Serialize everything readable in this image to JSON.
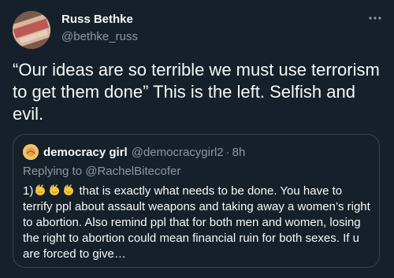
{
  "tweet": {
    "author": {
      "display_name": "Russ Bethke",
      "handle": "@bethke_russ"
    },
    "text": "“Our ideas are so terrible we must use terrorism to get them done” This is the left. Selfish and evil.",
    "more_icon": "more-horizontal-icon"
  },
  "quoted_tweet": {
    "author": {
      "display_name": "democracy girl",
      "handle": "@democracygirl2",
      "separator": "·",
      "time": "8h"
    },
    "replying_prefix": "Replying to ",
    "replying_to": "@RachelBitecofer",
    "body_prefix": "1)",
    "emoji": [
      "clapping-hands-icon",
      "clapping-hands-icon",
      "clapping-hands-icon"
    ],
    "body": " that is exactly what needs to be done. You have to terrify ppl about assault weapons and taking away a women’s right to abortion. Also remind ppl that for both men and women, losing the right to abortion could mean financial ruin for both sexes. If u are forced to give…"
  },
  "colors": {
    "background": "#15202b",
    "primary_text": "#f7f9f9",
    "secondary_text": "#8b98a5",
    "border": "#38444d"
  }
}
